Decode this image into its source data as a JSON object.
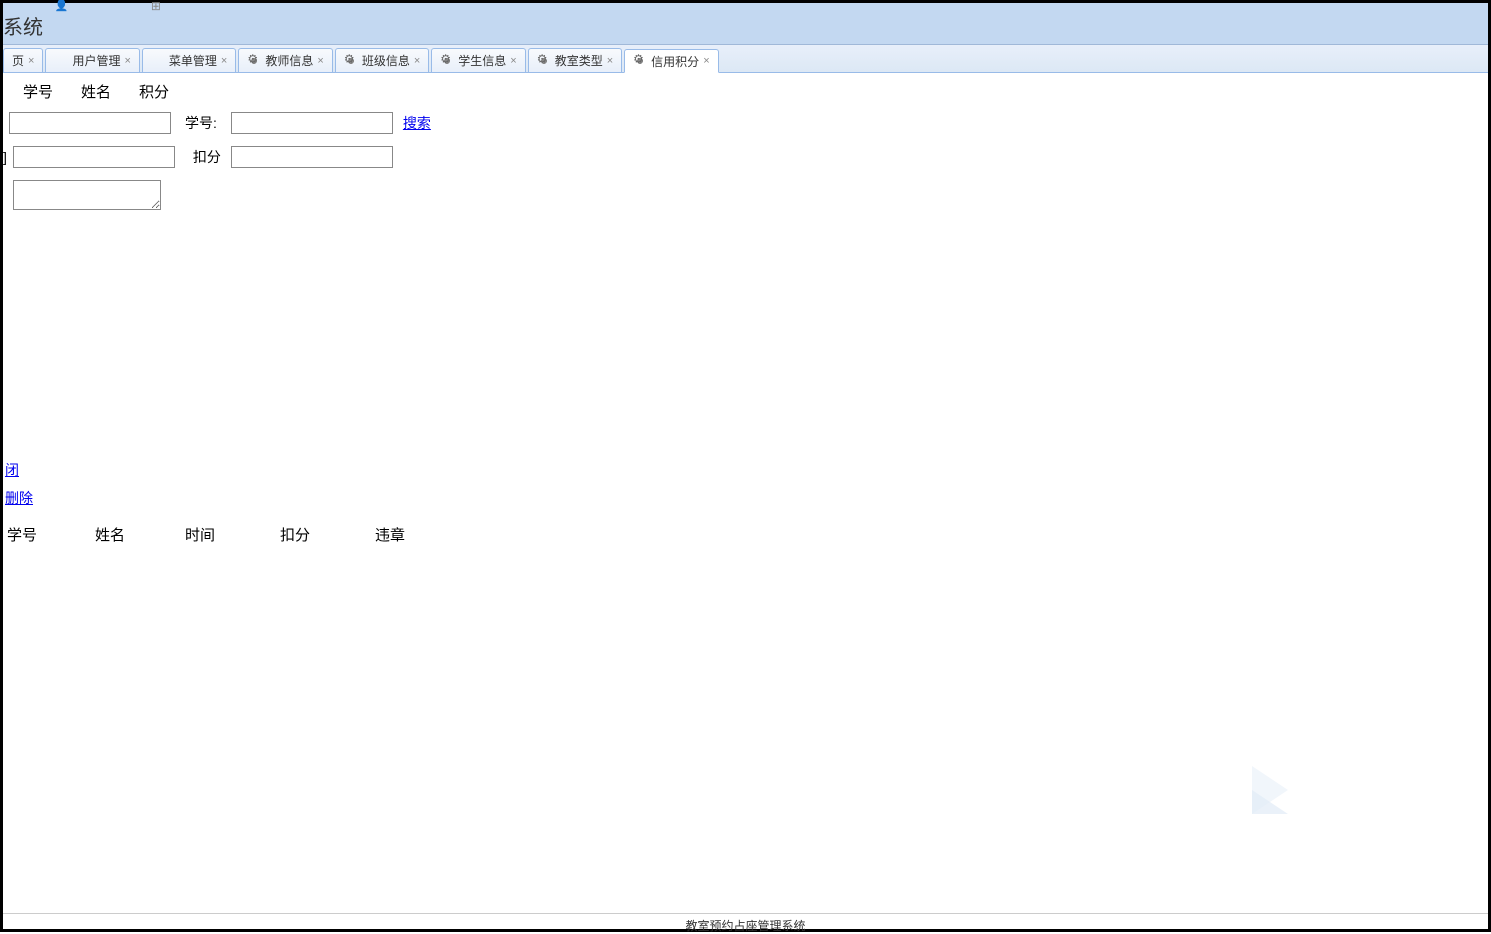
{
  "header": {
    "title": "系统"
  },
  "tabs": [
    {
      "label": "页",
      "icon": "home",
      "closable": true
    },
    {
      "label": "用户管理",
      "icon": "user",
      "closable": true
    },
    {
      "label": "菜单管理",
      "icon": "menu",
      "closable": true
    },
    {
      "label": "教师信息",
      "icon": "gear",
      "closable": true
    },
    {
      "label": "班级信息",
      "icon": "gear",
      "closable": true
    },
    {
      "label": "学生信息",
      "icon": "gear",
      "closable": true
    },
    {
      "label": "教室类型",
      "icon": "gear",
      "closable": true
    },
    {
      "label": "信用积分",
      "icon": "gear",
      "closable": true,
      "active": true
    }
  ],
  "top_columns": {
    "col1": "学号",
    "col2": "姓名",
    "col3": "积分"
  },
  "form": {
    "row1_label1": "",
    "row1_label2": "学号:",
    "search_link": "搜索",
    "row2_label1": "",
    "row2_label2": "扣分",
    "row3_label1": ""
  },
  "actions": {
    "link1": "闭",
    "link2": "删除"
  },
  "table_headers": {
    "h1": "学号",
    "h2": "姓名",
    "h3": "时间",
    "h4": "扣分",
    "h5": "违章"
  },
  "footer": {
    "text": "教室预约占座管理系统"
  }
}
